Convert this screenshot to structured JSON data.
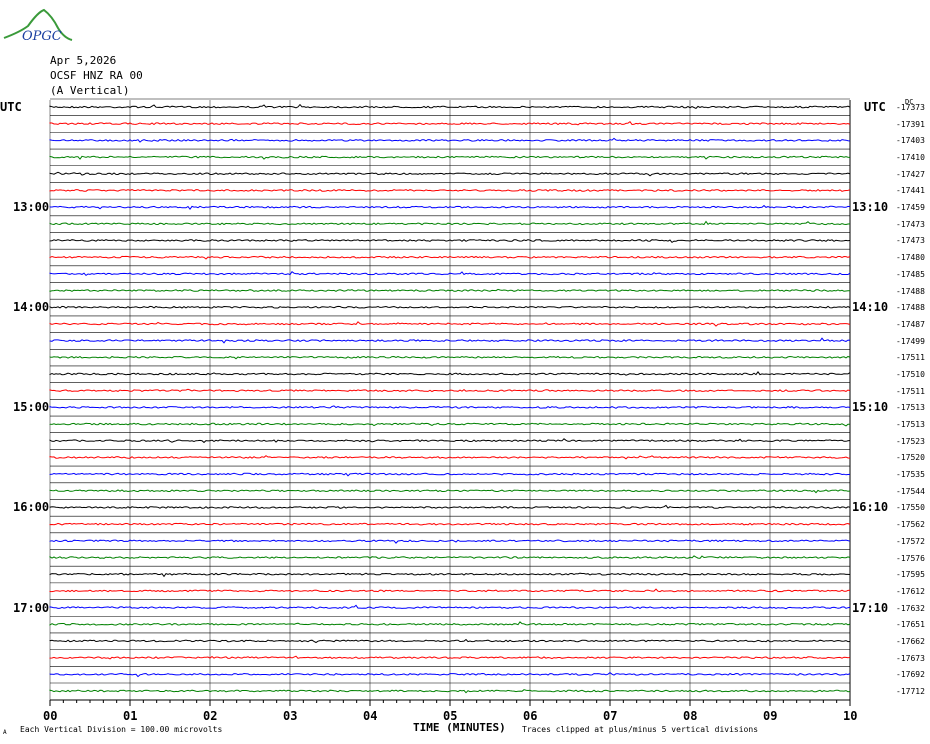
{
  "logo": {
    "text": "OPGC"
  },
  "header": {
    "date": "Apr 5,2026",
    "station": "OCSF HNZ RA 00",
    "component": "(A Vertical)"
  },
  "left_axis": {
    "title": "UTC",
    "hour_labels": [
      "13:00",
      "14:00",
      "15:00",
      "16:00",
      "17:00"
    ]
  },
  "right_axis": {
    "title": "UTC",
    "dc_label": "DC",
    "hour_labels": [
      "13:10",
      "14:10",
      "15:10",
      "16:10",
      "17:10"
    ]
  },
  "footer": {
    "scale_text": "Each Vertical Division =  100.00 microvolts",
    "axis_title": "TIME (MINUTES)",
    "clip_text": "Traces clipped at plus/minus 5 vertical divisions"
  },
  "chart_data": {
    "type": "line",
    "title": "OCSF HNZ RA 00 (A Vertical) Apr 5,2026",
    "xlabel": "TIME (MINUTES)",
    "x_ticks": [
      "00",
      "01",
      "02",
      "03",
      "04",
      "05",
      "06",
      "07",
      "08",
      "09",
      "10"
    ],
    "xlim": [
      0,
      10
    ],
    "rows_per_hour": 6,
    "trace_colors": [
      "#000000",
      "#ff0000",
      "#0000ff",
      "#008000"
    ],
    "dc_offsets": [
      -17373,
      -17391,
      -17403,
      -17410,
      -17427,
      -17441,
      -17459,
      -17473,
      -17473,
      -17480,
      -17485,
      -17488,
      -17488,
      -17487,
      -17499,
      -17511,
      -17510,
      -17511,
      -17513,
      -17513,
      -17523,
      -17520,
      -17535,
      -17544,
      -17550,
      -17562,
      -17572,
      -17576,
      -17595,
      -17612,
      -17632,
      -17651,
      -17662,
      -17673,
      -17692,
      -17712
    ]
  }
}
